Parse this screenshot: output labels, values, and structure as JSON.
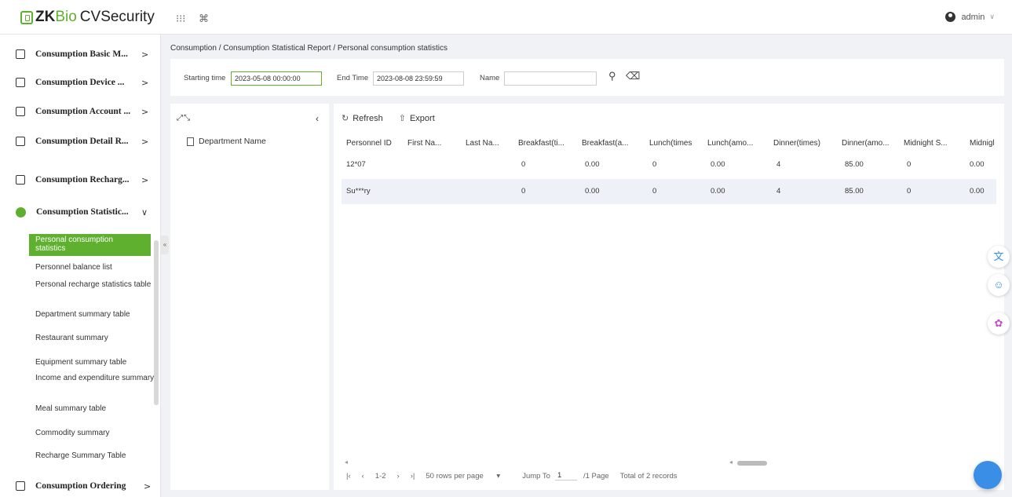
{
  "app": {
    "title_zk": "ZK",
    "title_bio": "Bio",
    "title_cv": "CVSecurity",
    "user": "admin"
  },
  "sidebar": {
    "menus": [
      {
        "label": "Consumption Basic M...",
        "arrow": ">"
      },
      {
        "label": "Consumption Device ...",
        "arrow": ">"
      },
      {
        "label": "Consumption Account ...",
        "arrow": ">"
      },
      {
        "label": "Consumption Detail R...",
        "arrow": ">"
      },
      {
        "label": "Consumption Recharg...",
        "arrow": ">"
      },
      {
        "label": "Consumption Statistic...",
        "arrow": "∨"
      },
      {
        "label": "Consumption Ordering",
        "arrow": ">"
      }
    ],
    "submenu": [
      "Personal consumption statistics",
      "Personnel balance list",
      "Personal recharge statistics table",
      "Department summary table",
      "Restaurant summary",
      "Equipment summary table",
      "Income and expenditure summary",
      "Meal summary table",
      "Commodity summary",
      "Recharge Summary Table"
    ]
  },
  "breadcrumb": "Consumption / Consumption Statistical Report / Personal consumption statistics",
  "filter": {
    "start_label": "Starting time",
    "start_value": "2023-05-08 00:00:00",
    "end_label": "End Time",
    "end_value": "2023-08-08 23:59:59",
    "name_label": "Name",
    "name_value": ""
  },
  "dept": {
    "header": "Department Name"
  },
  "toolbar": {
    "refresh": "Refresh",
    "export": "Export"
  },
  "table": {
    "columns": [
      "Personnel ID",
      "First Na...",
      "Last Na...",
      "Breakfast(ti...",
      "Breakfast(a...",
      "Lunch(times",
      "Lunch(amo...",
      "Dinner(times)",
      "Dinner(amo...",
      "Midnight S...",
      "Midnigl"
    ],
    "rows": [
      [
        "12*07",
        "",
        "",
        "0",
        "0.00",
        "0",
        "0.00",
        "4",
        "85.00",
        "0",
        "0.00"
      ],
      [
        "Su***ry",
        "",
        "",
        "0",
        "0.00",
        "0",
        "0.00",
        "4",
        "85.00",
        "0",
        "0.00"
      ]
    ]
  },
  "pager": {
    "range": "1-2",
    "rows_per_page": "50 rows per page",
    "jump_label": "Jump To",
    "jump_value": "1",
    "pages": "/1 Page",
    "total": "Total of 2 records"
  }
}
